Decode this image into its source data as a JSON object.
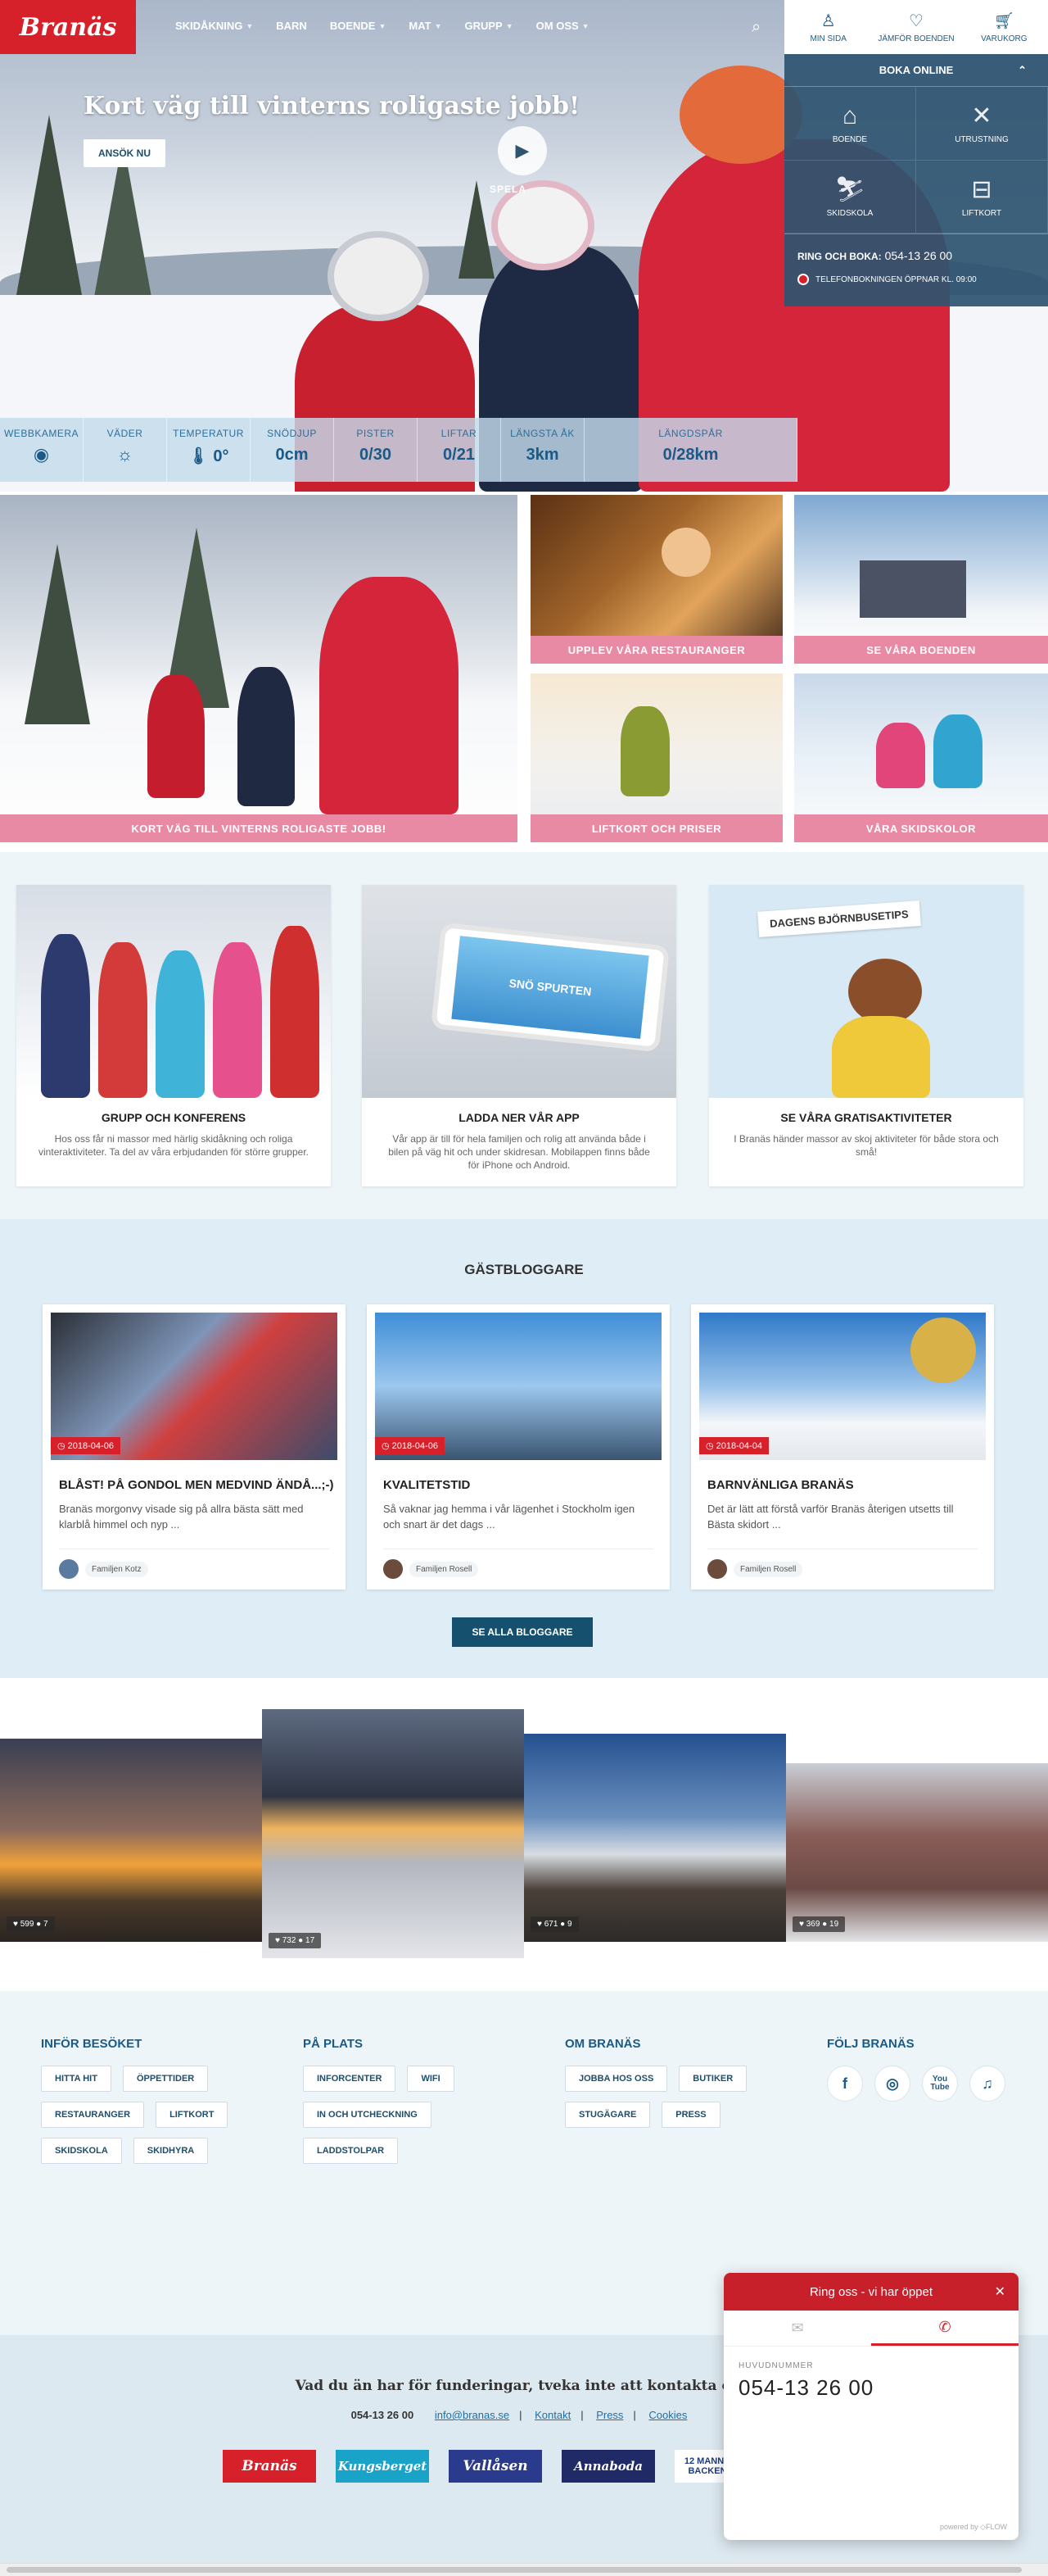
{
  "header": {
    "logo": "Branäs",
    "nav": [
      {
        "label": "SKIDÅKNING",
        "has_menu": true
      },
      {
        "label": "BARN",
        "has_menu": false
      },
      {
        "label": "BOENDE",
        "has_menu": true
      },
      {
        "label": "MAT",
        "has_menu": true
      },
      {
        "label": "GRUPP",
        "has_menu": true
      },
      {
        "label": "OM OSS",
        "has_menu": true
      }
    ],
    "right_nav": [
      {
        "icon": "user-icon",
        "label": "MIN SIDA"
      },
      {
        "icon": "heart-icon",
        "label": "JÄMFÖR BOENDEN"
      },
      {
        "icon": "cart-icon",
        "label": "VARUKORG"
      }
    ]
  },
  "hero": {
    "title": "Kort väg till vinterns roligaste jobb!",
    "button": "ANSÖK NU",
    "play_label": "SPELA"
  },
  "booking": {
    "title": "BOKA ONLINE",
    "items": [
      {
        "icon": "cabin-icon",
        "label": "BOENDE"
      },
      {
        "icon": "utensils-icon",
        "label": "UTRUSTNING"
      },
      {
        "icon": "skier-icon",
        "label": "SKIDSKOLA"
      },
      {
        "icon": "lift-icon",
        "label": "LIFTKORT"
      }
    ],
    "phone_label": "RING OCH BOKA:",
    "phone": "054-13 26 00",
    "note": "TELEFONBOKNINGEN ÖPPNAR KL. 09:00"
  },
  "stats": [
    {
      "label": "WEBBKAMERA",
      "value": "",
      "icon": "webcam-icon"
    },
    {
      "label": "VÄDER",
      "value": "",
      "icon": "sun-icon"
    },
    {
      "label": "TEMPERATUR",
      "value": "0°",
      "icon": "thermometer-icon"
    },
    {
      "label": "SNÖDJUP",
      "value": "0cm"
    },
    {
      "label": "PISTER",
      "value": "0/30"
    },
    {
      "label": "LIFTAR",
      "value": "0/21"
    },
    {
      "label": "LÄNGSTA ÅK",
      "value": "3km"
    },
    {
      "label": "LÄNGDSPÅR",
      "value": "0/28km"
    }
  ],
  "tiles": {
    "big": "KORT VÄG TILL VINTERNS ROLIGASTE JOBB!",
    "restaurants": "UPPLEV VÅRA RESTAURANGER",
    "lodging": "SE VÅRA BOENDEN",
    "liftpass": "LIFTKORT OCH PRISER",
    "skischool": "VÅRA SKIDSKOLOR"
  },
  "cards": [
    {
      "title": "GRUPP OCH KONFERENS",
      "text": "Hos oss får ni massor med härlig skidåkning och roliga vinteraktiviteter. Ta del av våra erbjudanden för större grupper."
    },
    {
      "title": "LADDA NER VÅR APP",
      "text": "Vår app är till för hela familjen och rolig att använda både i bilen på väg hit och under skidresan. Mobilappen finns både för iPhone och Android."
    },
    {
      "title": "SE VÅRA GRATISAKTIVITETER",
      "text": "I Branäs händer massor av skoj aktiviteter för både stora och små!"
    }
  ],
  "app_sign": "SNÖ SPURTEN",
  "tip_sign": "DAGENS BJÖRNBUSETIPS",
  "blog": {
    "title": "GÄSTBLOGGARE",
    "button": "SE ALLA BLOGGARE",
    "posts": [
      {
        "date": "2018-04-06",
        "title": "BLÅST! PÅ GONDOL MEN MEDVIND ÄNDÅ...;-)",
        "text": "Branäs morgonvy visade sig på allra bästa sätt med klarblå himmel och nyp ...",
        "author": "Familjen Kotz"
      },
      {
        "date": "2018-04-06",
        "title": "KVALITETSTID",
        "text": "Så vaknar jag hemma i vår lägenhet i Stockholm igen och snart är det dags ...",
        "author": "Familjen Rosell"
      },
      {
        "date": "2018-04-04",
        "title": "BARNVÄNLIGA BRANÄS",
        "text": "Det är lätt att förstå varför Branäs återigen utsetts till Bästa skidort ...",
        "author": "Familjen Rosell"
      }
    ]
  },
  "instagram": [
    {
      "likes": "599",
      "comments": "7"
    },
    {
      "likes": "732",
      "comments": "17"
    },
    {
      "likes": "671",
      "comments": "9"
    },
    {
      "likes": "369",
      "comments": "19"
    }
  ],
  "footer": {
    "cols": [
      {
        "title": "INFÖR BESÖKET",
        "links": [
          "HITTA HIT",
          "ÖPPETTIDER",
          "RESTAURANGER",
          "LIFTKORT",
          "SKIDSKOLA",
          "SKIDHYRA"
        ]
      },
      {
        "title": "PÅ PLATS",
        "links": [
          "INFORCENTER",
          "WIFI",
          "IN OCH UTCHECKNING",
          "LADDSTOLPAR"
        ]
      },
      {
        "title": "OM BRANÄS",
        "links": [
          "JOBBA HOS OSS",
          "BUTIKER",
          "STUGÄGARE",
          "PRESS"
        ]
      },
      {
        "title": "FÖLJ BRANÄS",
        "links": []
      }
    ],
    "social": [
      "f",
      "◎",
      "You Tube",
      "♫"
    ],
    "question": "Vad du än har för funderingar, tveka inte att kontakta oss!",
    "phone": "054-13 26 00",
    "email": "info@branas.se",
    "links": [
      "Kontakt",
      "Press",
      "Cookies"
    ],
    "partners": [
      "Branäs",
      "Kungsberget",
      "Vallåsen",
      "Annaboda",
      "12 MANNA BACKEN"
    ]
  },
  "call_widget": {
    "title": "Ring oss - vi har öppet",
    "label": "HUVUDNUMMER",
    "number": "054-13 26 00",
    "powered": "powered by ◇FLOW"
  },
  "colors": {
    "brand_red": "#d6202a",
    "brand_blue": "#1b5a86",
    "tile_caption": "#e98aa4"
  }
}
